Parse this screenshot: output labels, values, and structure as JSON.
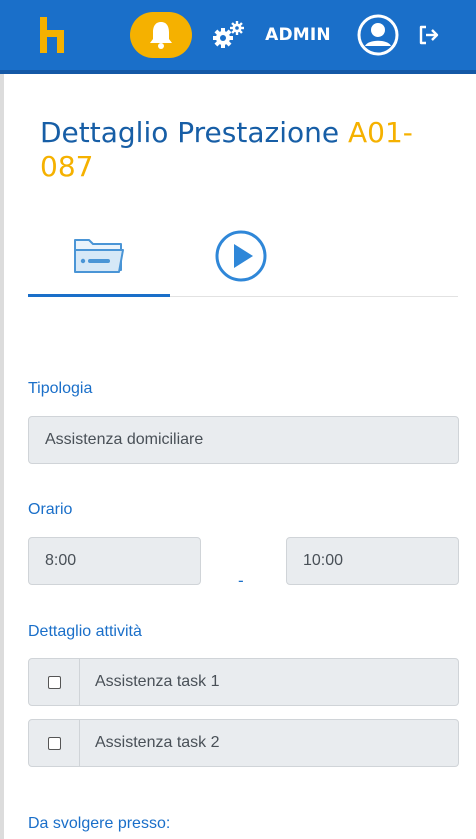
{
  "header": {
    "admin_label": "ADMIN",
    "accent": "#1a6fc9",
    "icons": [
      "logo-h-icon",
      "bell-icon",
      "gears-icon",
      "user-icon",
      "logout-icon"
    ]
  },
  "page": {
    "title": "Dettaglio Prestazione",
    "code": "A01-087"
  },
  "tabs": [
    {
      "icon": "folder-card-icon",
      "active": true
    },
    {
      "icon": "play-circle-icon",
      "active": false
    }
  ],
  "form": {
    "tipologia_label": "Tipologia",
    "tipologia_value": "Assistenza domiciliare",
    "orario_label": "Orario",
    "orario_from": "8:00",
    "orario_separator": "-",
    "orario_to": "10:00",
    "dettaglio_label": "Dettaglio attività",
    "tasks": [
      {
        "label": "Assistenza task 1",
        "checked": false
      },
      {
        "label": "Assistenza task 2",
        "checked": false
      }
    ],
    "presso_label": "Da svolgere presso:"
  }
}
